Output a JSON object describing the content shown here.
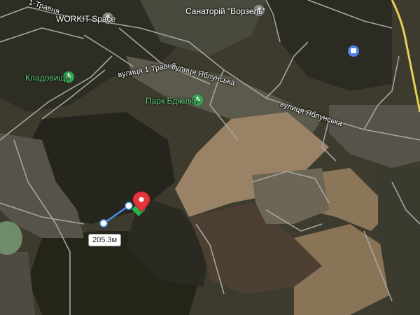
{
  "map": {
    "colors": {
      "forest": "#2b2a22",
      "field_light": "#8e7b60",
      "field_dark": "#4b3e32",
      "road": "#9a9a9a",
      "village": "#6b6a5d",
      "poi_green": "#5ad17a",
      "poi_grey": "#8c8c8c",
      "poi_blue": "#4f7fe8",
      "marker_red": "#e3353b",
      "marker_green": "#26b34a",
      "measure_line": "#4a8ff0"
    },
    "labels": {
      "street_1_travnia_top": "1-Травня",
      "street_1_travnia_mid": "вулиця 1 Травня",
      "street_yablunska_left": "вулиця Яблунська",
      "street_yablunska_right": "вулиця Яблунська",
      "workit": "WORKIT Space",
      "sanatorium": "Санаторій \"Ворзель\"",
      "cemetery": "Кладовище",
      "park": "Парк Бджілки"
    },
    "icons": {
      "workit": "grey-location-pin-icon",
      "sanatorium": "grey-location-pin-icon",
      "cemetery": "green-tree-pin-icon",
      "park": "green-tree-pin-icon",
      "bus": "blue-bus-stop-icon",
      "selected": "red-map-pin-icon"
    },
    "measure": {
      "distance_label": "205.3м",
      "distance_m": 205.3
    }
  }
}
